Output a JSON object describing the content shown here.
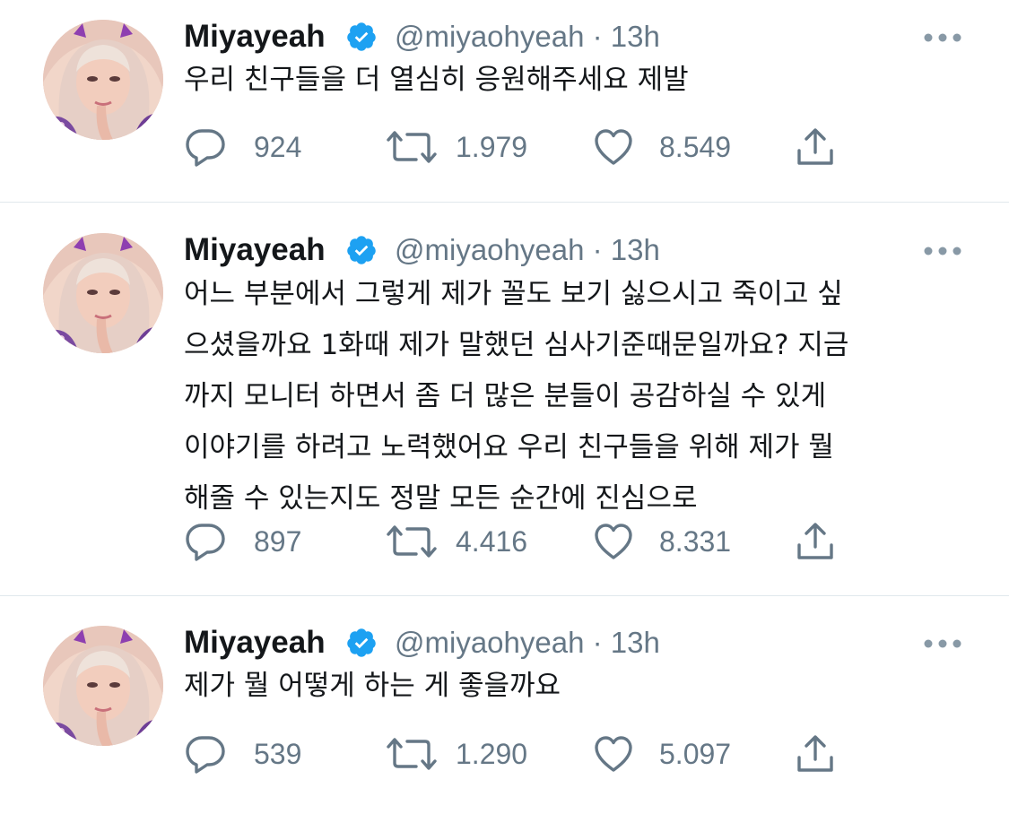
{
  "colors": {
    "text": "#14171a",
    "secondary": "#657786",
    "verified": "#1da1f2",
    "divider": "#e1e8ed"
  },
  "tweets": [
    {
      "display_name": "Miyayeah",
      "handle": "@miyaohyeah",
      "separator": "·",
      "time": "13h",
      "text_lines": [
        "우리 친구들을 더 열심히 응원해주세요 제발"
      ],
      "replies": "924",
      "retweets": "1.979",
      "likes": "8.549"
    },
    {
      "display_name": "Miyayeah",
      "handle": "@miyaohyeah",
      "separator": "·",
      "time": "13h",
      "text_lines": [
        "어느 부분에서 그렇게 제가 꼴도 보기 싫으시고 죽이고 싶",
        "으셨을까요 1화때 제가 말했던 심사기준때문일까요? 지금",
        "까지 모니터 하면서 좀 더 많은 분들이 공감하실 수 있게",
        "이야기를 하려고 노력했어요 우리 친구들을 위해 제가 뭘",
        "해줄 수 있는지도 정말 모든 순간에 진심으로"
      ],
      "replies": "897",
      "retweets": "4.416",
      "likes": "8.331"
    },
    {
      "display_name": "Miyayeah",
      "handle": "@miyaohyeah",
      "separator": "·",
      "time": "13h",
      "text_lines": [
        "제가 뭘 어떻게 하는 게 좋을까요"
      ],
      "replies": "539",
      "retweets": "1.290",
      "likes": "5.097"
    }
  ],
  "icons": {
    "reply": "speech-bubble-icon",
    "retweet": "retweet-arrows-icon",
    "like": "heart-icon",
    "share": "share-upload-icon",
    "more": "more-dots-icon",
    "verified": "verified-badge-icon"
  }
}
